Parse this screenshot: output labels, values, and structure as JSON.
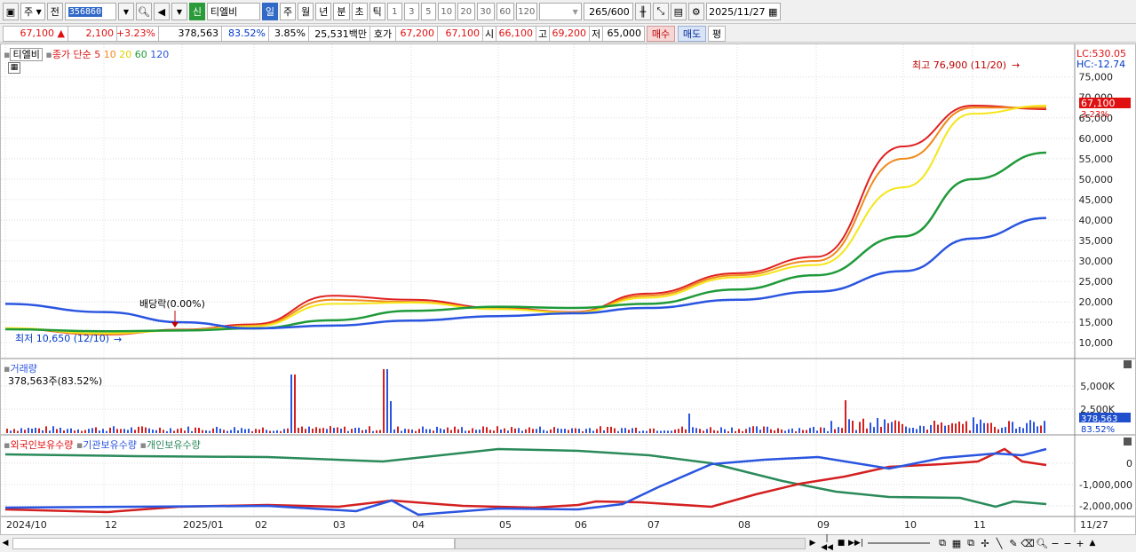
{
  "toolbar": {
    "market_type": "주",
    "prev": "전",
    "code": "356860",
    "new_badge": "신",
    "stock_name": "티엘비",
    "periods": [
      "일",
      "주",
      "월",
      "년",
      "분",
      "초",
      "틱"
    ],
    "selected_period": "일",
    "intervals": [
      "1",
      "3",
      "5",
      "10",
      "20",
      "30",
      "60",
      "120"
    ],
    "count": "265",
    "count_max": "/600",
    "date": "2025/11/27"
  },
  "quote": {
    "price": "67,100 ▲",
    "change": "2,100",
    "change_pct": "+3.23%",
    "volume": "378,563",
    "volume_ratio": "83.52%",
    "turnover_pct": "3.85%",
    "amount": "25,531백만",
    "hoga_label": "호가",
    "ask": "67,200",
    "bid": "67,100",
    "open_label": "시",
    "open": "66,100",
    "high_label": "고",
    "high": "69,200",
    "low_label": "저",
    "low": "65,000",
    "buy_button": "매수",
    "sell_button": "매도",
    "eval_button": "평"
  },
  "price_panel": {
    "stock_label": "티엘비",
    "ma_label": "종가 단순",
    "ma_periods": [
      "5",
      "10",
      "20",
      "60",
      "120"
    ],
    "ma_colors": [
      "#e02020",
      "#f08a1c",
      "#f5e61a",
      "#1f9a3a",
      "#2a55e0"
    ],
    "lc": "LC:530.05",
    "hc": "HC:-12.74",
    "current": "67,100",
    "current_pct": "3.23%",
    "high_annotation": "최고 76,900 (11/20)",
    "low_annotation": "최저 10,650 (12/10)",
    "dividend_annotation": "배당락(0.00%)",
    "y_ticks": [
      "75,000",
      "70,000",
      "65,000",
      "60,000",
      "55,000",
      "50,000",
      "45,000",
      "40,000",
      "35,000",
      "30,000",
      "25,000",
      "20,000",
      "15,000",
      "10,000"
    ]
  },
  "volume_panel": {
    "label": "거래량",
    "value": "378,563주(83.52%)",
    "y_ticks": [
      "5,000K",
      "2,500K"
    ],
    "current": "378,563",
    "current_pct": "83.52%"
  },
  "holdings_panel": {
    "series": [
      {
        "name": "외국인보유수량",
        "color": "#e02020"
      },
      {
        "name": "기관보유수량",
        "color": "#2a55e0"
      },
      {
        "name": "개인보유수량",
        "color": "#2a8a5a"
      }
    ],
    "y_ticks": [
      "0",
      "-1,000,000",
      "-2,000,000"
    ]
  },
  "x_axis": {
    "labels": [
      "2024/10",
      "12",
      "2025/01",
      "02",
      "03",
      "04",
      "05",
      "06",
      "07",
      "08",
      "09",
      "10",
      "11"
    ],
    "last_date": "11/27"
  },
  "chart_data": {
    "type": "line",
    "title": "",
    "xlabel": "",
    "ylabel": "",
    "x": [
      "2024/10",
      "12",
      "2025/01",
      "02",
      "03",
      "04",
      "05",
      "06",
      "07",
      "08",
      "09",
      "10",
      "11",
      "11/27"
    ],
    "ylim": [
      7000,
      78000
    ],
    "series": [
      {
        "name": "5",
        "values": [
          13500,
          12000,
          13200,
          14500,
          21500,
          20500,
          18500,
          17500,
          22000,
          27000,
          31000,
          58000,
          68000,
          67100
        ]
      },
      {
        "name": "10",
        "values": [
          13500,
          12100,
          13100,
          14200,
          20500,
          20000,
          18300,
          17400,
          21500,
          26500,
          30000,
          55000,
          67500,
          67500
        ]
      },
      {
        "name": "20",
        "values": [
          13600,
          12300,
          13000,
          14000,
          19500,
          19800,
          18200,
          17300,
          21000,
          26000,
          29000,
          48000,
          66000,
          68000
        ]
      },
      {
        "name": "60",
        "values": [
          13300,
          12800,
          13000,
          13500,
          15500,
          17800,
          18800,
          18500,
          19500,
          23000,
          26500,
          36000,
          50000,
          56500
        ]
      },
      {
        "name": "120",
        "values": [
          19500,
          17500,
          15000,
          13500,
          14200,
          15400,
          16500,
          17200,
          18500,
          20500,
          22500,
          27500,
          35500,
          40500
        ]
      }
    ]
  }
}
